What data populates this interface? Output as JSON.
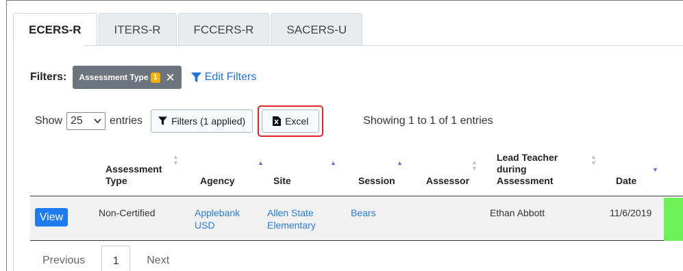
{
  "tabs": [
    {
      "label": "ECERS-R",
      "active": true
    },
    {
      "label": "ITERS-R",
      "active": false
    },
    {
      "label": "FCCERS-R",
      "active": false
    },
    {
      "label": "SACERS-U",
      "active": false
    }
  ],
  "filters": {
    "label": "Filters:",
    "chip_label": "Assessment Type",
    "chip_count": "1",
    "edit_label": "Edit Filters"
  },
  "controls": {
    "show_label": "Show",
    "entries_value": "25",
    "entries_label": "entries",
    "filters_button": "Filters (1 applied)",
    "excel_button": "Excel",
    "showing_text": "Showing 1 to 1 of 1 entries"
  },
  "table": {
    "columns": [
      "Assessment Type",
      "Agency",
      "Site",
      "Session",
      "Assessor",
      "Lead Teacher during Assessment",
      "Date"
    ],
    "rows": [
      {
        "action": "View",
        "assessment_type": "Non-Certified",
        "agency": "Applebank USD",
        "site": "Allen State Elementary",
        "session": "Bears",
        "assessor": "",
        "lead_teacher": "Ethan Abbott",
        "date": "11/6/2019",
        "status_color": "#6ef255"
      }
    ]
  },
  "pagination": {
    "previous": "Previous",
    "page": "1",
    "next": "Next"
  },
  "colors": {
    "accent": "#1e7bf0",
    "link": "#2a7ae2",
    "highlight_border": "#e0242a",
    "badge": "#f0b400"
  }
}
